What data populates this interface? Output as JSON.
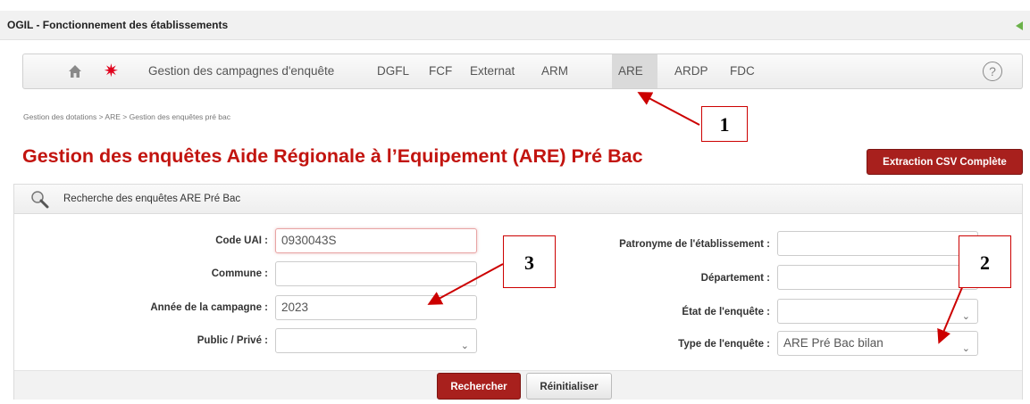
{
  "app": {
    "title": "OGIL - Fonctionnement des établissements"
  },
  "nav": {
    "items": [
      {
        "label": "Gestion des campagnes d'enquête"
      },
      {
        "label": "DGFL"
      },
      {
        "label": "FCF"
      },
      {
        "label": "Externat"
      },
      {
        "label": "ARM"
      },
      {
        "label": "ARE"
      },
      {
        "label": "ARDP"
      },
      {
        "label": "FDC"
      }
    ],
    "active": "ARE",
    "help": "?"
  },
  "breadcrumb": "Gestion des dotations > ARE > Gestion des enquêtes pré bac",
  "page": {
    "title": "Gestion des enquêtes Aide Régionale à l’Equipement (ARE) Pré Bac",
    "export_button": "Extraction CSV Complète"
  },
  "search_panel": {
    "title": "Recherche des enquêtes ARE Pré Bac",
    "fields": {
      "code_uai": {
        "label": "Code UAI :",
        "value": "0930043S"
      },
      "commune": {
        "label": "Commune :",
        "value": ""
      },
      "annee": {
        "label": "Année de la campagne :",
        "value": "2023"
      },
      "public_prive": {
        "label": "Public / Privé :",
        "value": ""
      },
      "patronyme": {
        "label": "Patronyme de l'établissement :",
        "value": ""
      },
      "departement": {
        "label": "Département :",
        "value": ""
      },
      "etat": {
        "label": "État de l'enquête :",
        "value": ""
      },
      "type": {
        "label": "Type de l'enquête :",
        "value": "ARE Pré Bac bilan"
      }
    },
    "search_button": "Rechercher",
    "reset_button": "Réinitialiser"
  },
  "callouts": [
    "1",
    "2",
    "3"
  ],
  "colors": {
    "brand_red": "#c2140f",
    "button_red": "#a8201d",
    "annotation_red": "#cc0000"
  },
  "icons": [
    "home-icon",
    "star-icon",
    "help-icon",
    "search-magnifier-icon",
    "back-arrow-icon",
    "chevron-down-icon"
  ]
}
